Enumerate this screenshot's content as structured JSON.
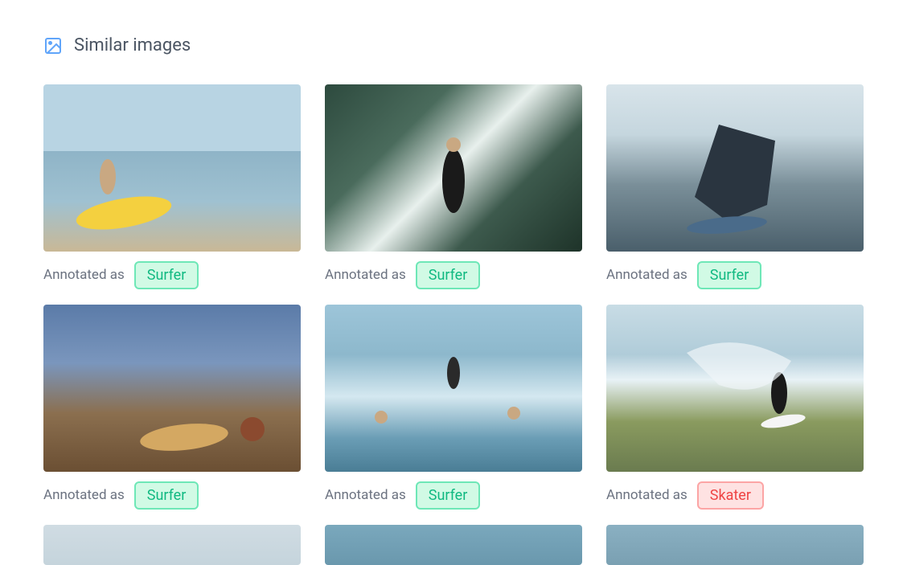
{
  "header": {
    "title": "Similar images"
  },
  "annotated_as_label": "Annotated as",
  "badge_styles": {
    "Surfer": "badge-surfer",
    "Skater": "badge-skater"
  },
  "items": [
    {
      "annotation": "Surfer",
      "thumb_class": "thumb-1"
    },
    {
      "annotation": "Surfer",
      "thumb_class": "thumb-2"
    },
    {
      "annotation": "Surfer",
      "thumb_class": "thumb-3"
    },
    {
      "annotation": "Surfer",
      "thumb_class": "thumb-4"
    },
    {
      "annotation": "Surfer",
      "thumb_class": "thumb-5"
    },
    {
      "annotation": "Skater",
      "thumb_class": "thumb-6"
    },
    {
      "annotation": null,
      "thumb_class": "thumb-7"
    },
    {
      "annotation": null,
      "thumb_class": "thumb-8"
    },
    {
      "annotation": null,
      "thumb_class": "thumb-9"
    }
  ]
}
